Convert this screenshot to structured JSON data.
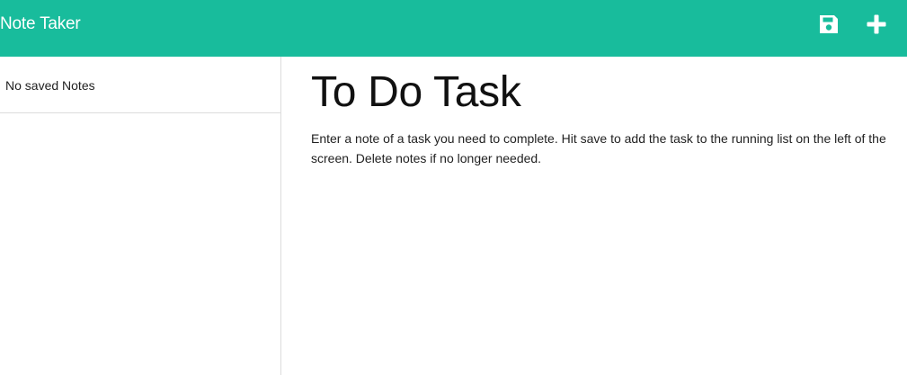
{
  "navbar": {
    "brand": "Note Taker",
    "icons": {
      "save": "save-icon",
      "add": "plus-icon"
    },
    "color": "#18bc9c"
  },
  "sidebar": {
    "items": [
      {
        "label": "No saved Notes"
      }
    ]
  },
  "note": {
    "title": "To Do Task",
    "text": "Enter a note of a task you need to complete. Hit save to add the task to the running list on the left of the screen. Delete notes if no longer needed."
  }
}
